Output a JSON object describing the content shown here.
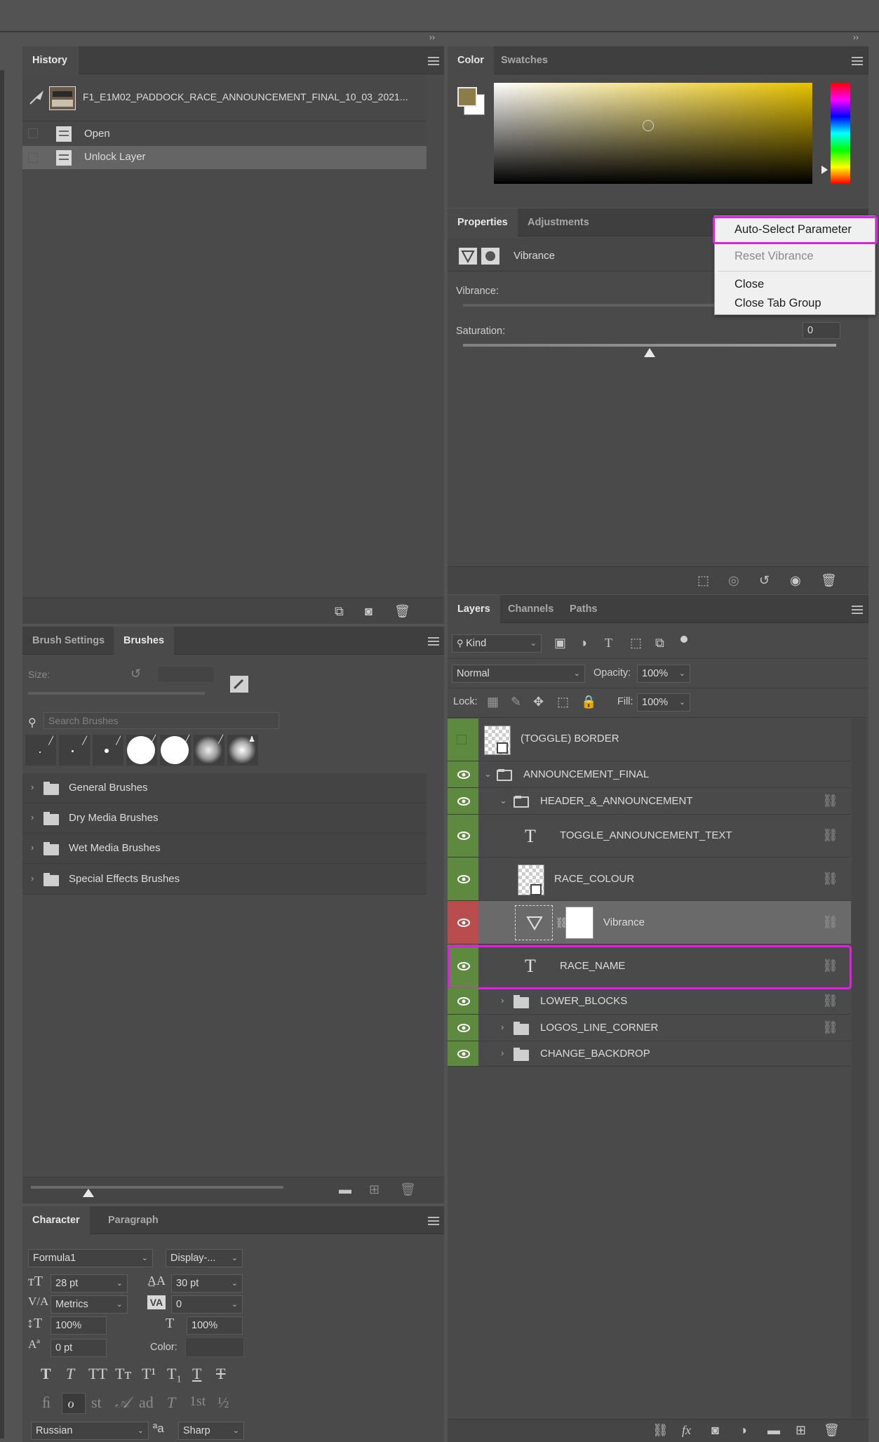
{
  "history": {
    "tab": "History",
    "snapshot": "F1_E1M02_PADDOCK_RACE_ANNOUNCEMENT_FINAL_10_03_2021...",
    "states": [
      "Open",
      "Unlock Layer"
    ]
  },
  "brushes": {
    "tabs": [
      "Brush Settings",
      "Brushes"
    ],
    "size_label": "Size:",
    "search_placeholder": "Search Brushes",
    "folders": [
      "General Brushes",
      "Dry Media Brushes",
      "Wet Media Brushes",
      "Special Effects Brushes"
    ]
  },
  "character": {
    "tabs": [
      "Character",
      "Paragraph"
    ],
    "font_family": "Formula1",
    "font_style": "Display-...",
    "font_size": "28 pt",
    "leading": "30 pt",
    "kerning": "Metrics",
    "tracking": "0",
    "vertical_scale": "100%",
    "horizontal_scale": "100%",
    "baseline_shift": "0 pt",
    "color_label": "Color:",
    "language": "Russian",
    "antialias_icon": "ªa",
    "antialias": "Sharp",
    "type_styles": [
      "T",
      "T",
      "TT",
      "Tт",
      "T¹",
      "T₁",
      "T",
      "T"
    ],
    "opentype": [
      "ﬁ",
      "ℴ",
      "st",
      "𝒜",
      "ad",
      "T",
      "1st",
      "½"
    ]
  },
  "color": {
    "tabs": [
      "Color",
      "Swatches"
    ],
    "foreground": "#8b7d4a",
    "background": "#ffffff",
    "hue": "#e8c200"
  },
  "properties": {
    "tabs": [
      "Properties",
      "Adjustments"
    ],
    "layer_label": "Vibrance",
    "vibrance_label": "Vibrance:",
    "saturation_label": "Saturation:",
    "saturation_value": "0",
    "saturation_level": 0.5
  },
  "context_menu": {
    "items": [
      "Auto-Select Parameter",
      "Reset Vibrance",
      "Close",
      "Close Tab Group"
    ]
  },
  "layers": {
    "tabs": [
      "Layers",
      "Channels",
      "Paths"
    ],
    "filter": "Kind",
    "blend_mode": "Normal",
    "opacity_label": "Opacity:",
    "opacity": "100%",
    "lock_label": "Lock:",
    "fill_label": "Fill:",
    "fill": "100%",
    "rows": [
      {
        "name": "(TOGGLE) BORDER"
      },
      {
        "name": "ANNOUNCEMENT_FINAL"
      },
      {
        "name": "HEADER_&_ANNOUNCEMENT"
      },
      {
        "name": "TOGGLE_ANNOUNCEMENT_TEXT"
      },
      {
        "name": "RACE_COLOUR"
      },
      {
        "name": "Vibrance"
      },
      {
        "name": "RACE_NAME"
      },
      {
        "name": "LOWER_BLOCKS"
      },
      {
        "name": "LOGOS_LINE_CORNER"
      },
      {
        "name": "CHANGE_BACKDROP"
      }
    ],
    "footer_icons": [
      "link-icon",
      "fx-icon",
      "mask-icon",
      "adjustment-icon",
      "group-icon",
      "new-layer-icon",
      "trash-icon"
    ]
  },
  "highlight_color": "#e020e0"
}
